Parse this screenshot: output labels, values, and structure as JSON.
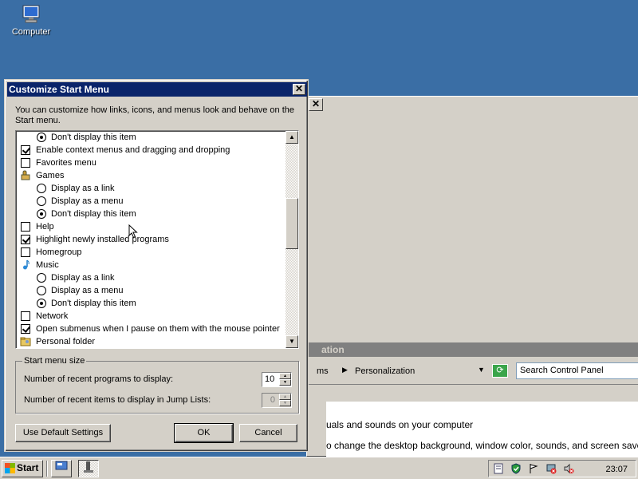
{
  "desktop": {
    "icons": [
      {
        "label": "Computer",
        "icon": "computer-icon"
      }
    ],
    "background_color": "#3a6ea5"
  },
  "background_window": {
    "title": "Appearance and Personalization",
    "title_visible": "ation",
    "breadcrumb_partial": "ms",
    "breadcrumb": "Personalization",
    "search_placeholder": "Search Control Panel",
    "content_lines": [
      "uals and sounds on your computer",
      "o change the desktop background, window color, sounds, and screen save"
    ]
  },
  "dialog": {
    "title": "Customize Start Menu",
    "close_label": "✕",
    "intro": "You can customize how links, icons, and menus look and behave on the Start menu.",
    "items": [
      {
        "type": "radio",
        "label": "Don't display this item",
        "checked": true
      },
      {
        "type": "checkbox",
        "label": "Enable context menus and dragging and dropping",
        "checked": true
      },
      {
        "type": "checkbox",
        "label": "Favorites menu",
        "checked": false
      },
      {
        "type": "header",
        "label": "Games",
        "icon": "games-icon"
      },
      {
        "type": "radio",
        "label": "Display as a link",
        "checked": false
      },
      {
        "type": "radio",
        "label": "Display as a menu",
        "checked": false
      },
      {
        "type": "radio",
        "label": "Don't display this item",
        "checked": true
      },
      {
        "type": "checkbox",
        "label": "Help",
        "checked": false
      },
      {
        "type": "checkbox",
        "label": "Highlight newly installed programs",
        "checked": true
      },
      {
        "type": "checkbox",
        "label": "Homegroup",
        "checked": false
      },
      {
        "type": "header",
        "label": "Music",
        "icon": "music-note-icon"
      },
      {
        "type": "radio",
        "label": "Display as a link",
        "checked": false
      },
      {
        "type": "radio",
        "label": "Display as a menu",
        "checked": false
      },
      {
        "type": "radio",
        "label": "Don't display this item",
        "checked": true
      },
      {
        "type": "checkbox",
        "label": "Network",
        "checked": false
      },
      {
        "type": "checkbox",
        "label": "Open submenus when I pause on them with the mouse pointer",
        "checked": true
      },
      {
        "type": "header",
        "label": "Personal folder",
        "icon": "folder-icon"
      }
    ],
    "start_menu_size": {
      "legend": "Start menu size",
      "recent_programs_label": "Number of recent programs to display:",
      "recent_programs_value": "10",
      "jump_lists_label": "Number of recent items to display in Jump Lists:",
      "jump_lists_value": "0"
    },
    "buttons": {
      "default_settings": "Use Default Settings",
      "ok": "OK",
      "cancel": "Cancel"
    }
  },
  "taskbar": {
    "start_label": "Start",
    "clock": "23:07"
  }
}
